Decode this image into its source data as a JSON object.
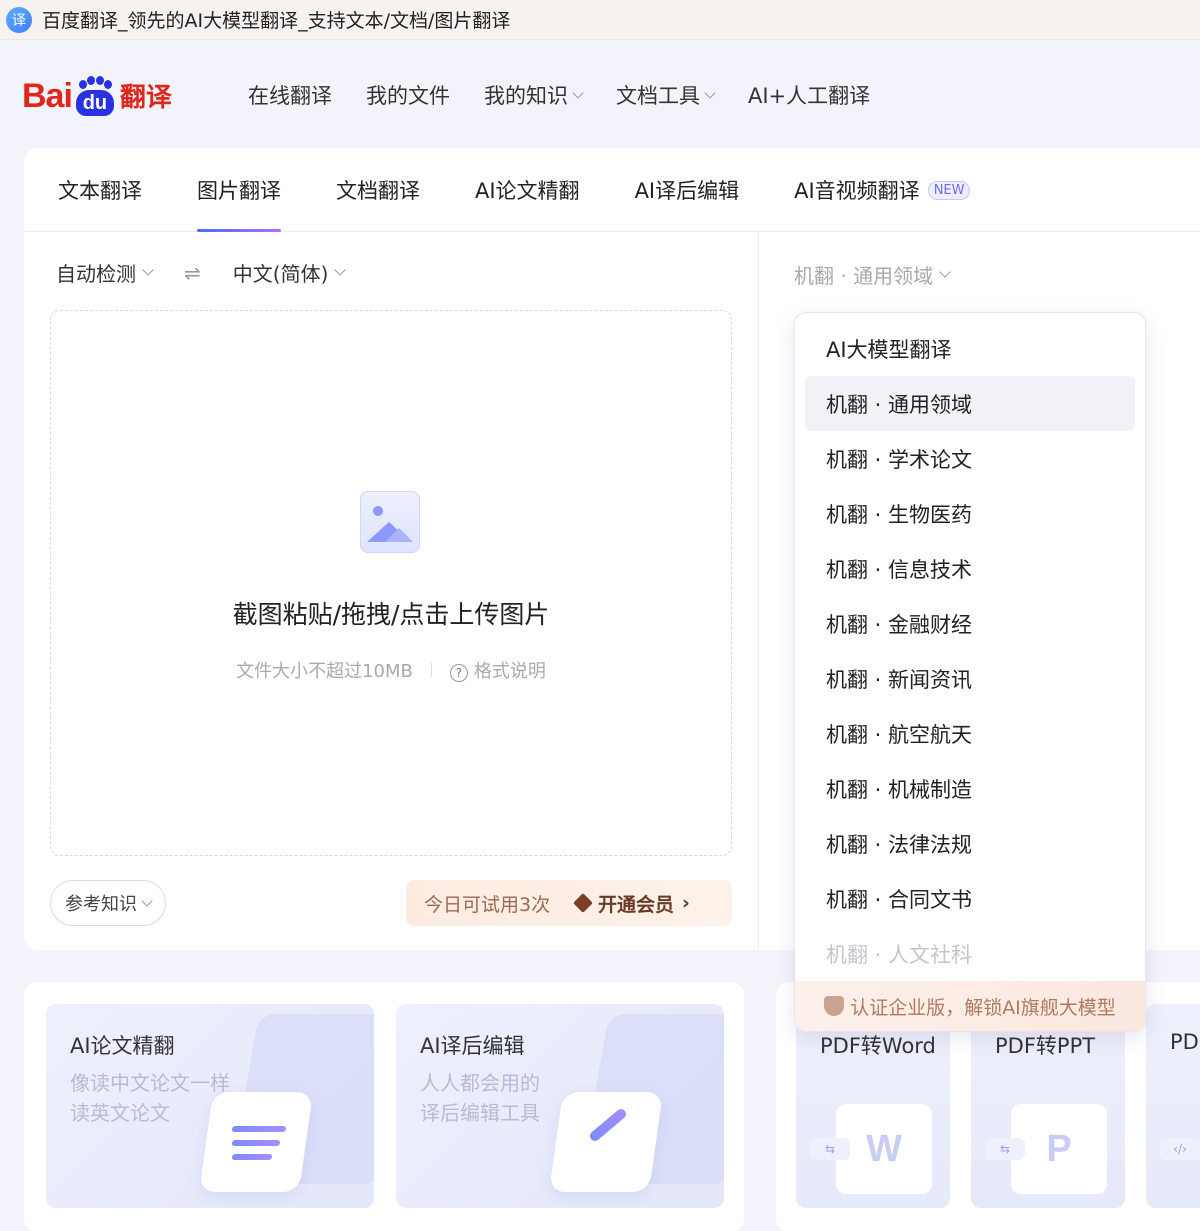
{
  "browser": {
    "tab_title": "百度翻译_领先的AI大模型翻译_支持文本/文档/图片翻译",
    "favicon_glyph": "译"
  },
  "header": {
    "logo": {
      "bai": "Bai",
      "du": "du",
      "fanyi": "翻译"
    },
    "nav": [
      {
        "label": "在线翻译",
        "has_dropdown": false
      },
      {
        "label": "我的文件",
        "has_dropdown": false
      },
      {
        "label": "我的知识",
        "has_dropdown": true
      },
      {
        "label": "文档工具",
        "has_dropdown": true
      },
      {
        "label": "AI+人工翻译",
        "has_dropdown": false
      }
    ]
  },
  "tabs": [
    {
      "label": "文本翻译",
      "active": false
    },
    {
      "label": "图片翻译",
      "active": true
    },
    {
      "label": "文档翻译",
      "active": false
    },
    {
      "label": "AI论文精翻",
      "active": false
    },
    {
      "label": "AI译后编辑",
      "active": false
    },
    {
      "label": "AI音视频翻译",
      "active": false,
      "badge": "NEW"
    }
  ],
  "lang": {
    "source": "自动检测",
    "swap": "⇌",
    "target": "中文(简体)"
  },
  "upload": {
    "title": "截图粘贴/拖拽/点击上传图片",
    "size_hint": "文件大小不超过10MB",
    "format_link": "格式说明",
    "format_icon": "?"
  },
  "footer_controls": {
    "reference": "参考知识",
    "trial": "今日可试用3次",
    "vip": "开通会员",
    "vip_arrow": "›"
  },
  "engine": {
    "current": "机翻 · 通用领域",
    "options": [
      {
        "label": "AI大模型翻译",
        "selected": false,
        "faded": false
      },
      {
        "label": "机翻 · 通用领域",
        "selected": true,
        "faded": false
      },
      {
        "label": "机翻 · 学术论文",
        "selected": false,
        "faded": false
      },
      {
        "label": "机翻 · 生物医药",
        "selected": false,
        "faded": false
      },
      {
        "label": "机翻 · 信息技术",
        "selected": false,
        "faded": false
      },
      {
        "label": "机翻 · 金融财经",
        "selected": false,
        "faded": false
      },
      {
        "label": "机翻 · 新闻资讯",
        "selected": false,
        "faded": false
      },
      {
        "label": "机翻 · 航空航天",
        "selected": false,
        "faded": false
      },
      {
        "label": "机翻 · 机械制造",
        "selected": false,
        "faded": false
      },
      {
        "label": "机翻 · 法律法规",
        "selected": false,
        "faded": false
      },
      {
        "label": "机翻 · 合同文书",
        "selected": false,
        "faded": false
      },
      {
        "label": "机翻 · 人文社科",
        "selected": false,
        "faded": true
      }
    ],
    "enterprise_banner": "认证企业版，解锁AI旗舰大模型"
  },
  "features": [
    {
      "title": "AI论文精翻",
      "line1": "像读中文论文一样",
      "line2": "读英文论文",
      "icon": "document-lines-icon"
    },
    {
      "title": "AI译后编辑",
      "line1": "人人都会用的",
      "line2": "译后编辑工具",
      "icon": "pen-edit-icon"
    }
  ],
  "tools": [
    {
      "title": "PDF转Word",
      "glyph": "W",
      "tag": "⇆"
    },
    {
      "title": "PDF转PPT",
      "glyph": "P",
      "tag": "⇆"
    },
    {
      "title": "PD",
      "glyph": "",
      "tag": "‹/›"
    }
  ],
  "colors": {
    "brand_red": "#e1261c",
    "brand_blue": "#2932e1",
    "accent_gradient_start": "#4a6cff",
    "accent_gradient_end": "#b56bff"
  }
}
